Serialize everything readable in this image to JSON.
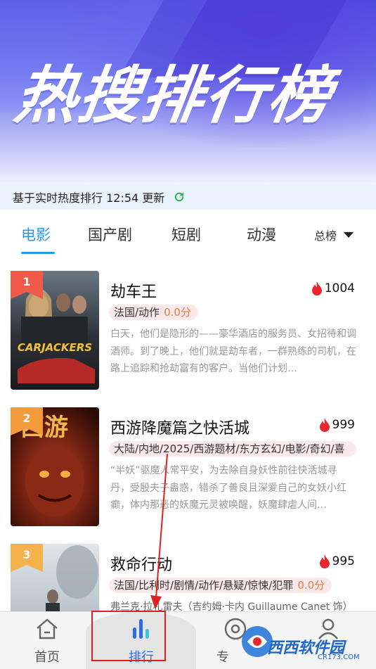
{
  "banner": {
    "title": "热搜排行榜"
  },
  "update": {
    "text": "基于实时热度排行 12:54 更新"
  },
  "tabs": [
    {
      "label": "电影",
      "active": true
    },
    {
      "label": "国产剧",
      "active": false
    },
    {
      "label": "短剧",
      "active": false
    },
    {
      "label": "动漫",
      "active": false
    }
  ],
  "dropdown": {
    "label": "总榜"
  },
  "items": [
    {
      "rank": "1",
      "title": "劫车王",
      "hot": "1004",
      "tags": "法国/动作",
      "score": "0.0分",
      "desc": "白天，他们是隐形的——豪华酒店的服务员、女招待和调酒师。到了晚上，他们就是劫车者，一群熟练的司机，在路上追踪和抢劫富有的客户。当他们计划…",
      "poster_text": "CARJACKERS"
    },
    {
      "rank": "2",
      "title": "西游降魔篇之快活城",
      "hot": "999",
      "tags": "大陆/内地/2025/西游题材/东方玄幻/电影/奇幻/喜",
      "score": "",
      "desc": "“半妖”驱魔人常平安，为去除自身妖性前往快活城寻丹，受殷夫子蛊惑，错杀了善良且深爱自己的女妖小红癫，体内那恶的妖魔元灵被唤醒，妖魔肆虐人间…",
      "poster_text": "西游"
    },
    {
      "rank": "3",
      "title": "救命行动",
      "hot": "995",
      "tags": "法国/比利时/剧情/动作/悬疑/惊悚/犯罪",
      "score": "0.0分",
      "desc": "弗兰克·拉札雷夫（吉约姆·卡内 Guillaume Canet 饰）",
      "poster_text": ""
    }
  ],
  "nav": [
    {
      "label": "首页",
      "icon": "home-icon"
    },
    {
      "label": "排行",
      "icon": "ranking-icon"
    },
    {
      "label": "专",
      "icon": "disc-icon"
    },
    {
      "label": "",
      "icon": "user-icon"
    }
  ],
  "watermark": {
    "text": "西西软件园",
    "sub": "CR173.COM"
  },
  "colors": {
    "accent": "#2b97e5",
    "hot": "#e8262c",
    "rank1": "#f05a4a",
    "rank2": "#f39a3a",
    "rank3": "#f5b24a"
  }
}
